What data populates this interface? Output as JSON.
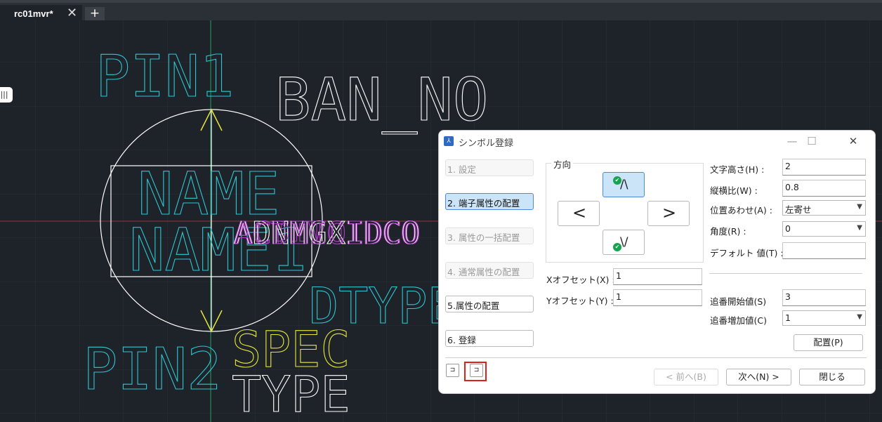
{
  "tabs": {
    "file_label": "rc01mvr*",
    "close_glyph": "✕",
    "add_glyph": "+"
  },
  "side_handle_glyph": "|||",
  "cad": {
    "texts": {
      "pin1": "PIN1",
      "ban_no": "BAN_NO",
      "name": "NAME",
      "name1": "NAME1",
      "dtype": "DTYPE",
      "pin2": "PIN2",
      "spec": "SPEC",
      "type": "TYPE",
      "overlap_1": "ACTIVCIDCO",
      "overlap_2": "ADNMGXIDCO",
      "overlap_3": "ACDMIOIDCO"
    },
    "colors": {
      "cyan": "#2ec7d3",
      "white": "#ffffff",
      "yellow": "#e6e63a",
      "magenta": "#b03cc8",
      "grid": "#2b3038",
      "axis_green": "#1f9b58",
      "axis_red": "#8a3a3a"
    }
  },
  "dialog": {
    "title": "シンボル登録",
    "window_controls": {
      "minimize": "—",
      "maximize": "☐",
      "close": "✕"
    },
    "steps": [
      {
        "label": "1. 設定",
        "state": "disabled"
      },
      {
        "label": "2. 端子属性の配置",
        "state": "active"
      },
      {
        "label": "3. 属性の一括配置",
        "state": "disabled"
      },
      {
        "label": "4. 通常属性の配置",
        "state": "disabled"
      },
      {
        "label": "5.属性の配置",
        "state": "enabled"
      },
      {
        "label": "6. 登録",
        "state": "enabled"
      }
    ],
    "direction": {
      "label": "方向",
      "up": "/\\",
      "left": "<",
      "right": ">",
      "down": "\\/",
      "selected": "up"
    },
    "x_offset": {
      "label": "Xオフセット(X) :",
      "value": "1"
    },
    "y_offset": {
      "label": "Yオフセット(Y) :",
      "value": "1"
    },
    "text_height": {
      "label": "文字高さ(H) :",
      "value": "2"
    },
    "aspect_ratio": {
      "label": "縦横比(W) :",
      "value": "0.8"
    },
    "alignment": {
      "label": "位置あわせ(A) :",
      "value": "左寄せ"
    },
    "angle": {
      "label": "角度(R) :",
      "value": "0"
    },
    "default_value": {
      "label": "デフォルト 値(T) :",
      "value": ""
    },
    "seq_start": {
      "label": "追番開始値(S)",
      "value": "3"
    },
    "seq_increment": {
      "label": "追番増加値(C)",
      "value": "1"
    },
    "place_button": "配置(P)",
    "back_button": "< 前へ(B)",
    "next_button": "次へ(N) >",
    "close_button": "閉じる",
    "mini_icon_1": "⊐",
    "mini_icon_2": "⊐",
    "highlight_color": "#e0201c"
  }
}
